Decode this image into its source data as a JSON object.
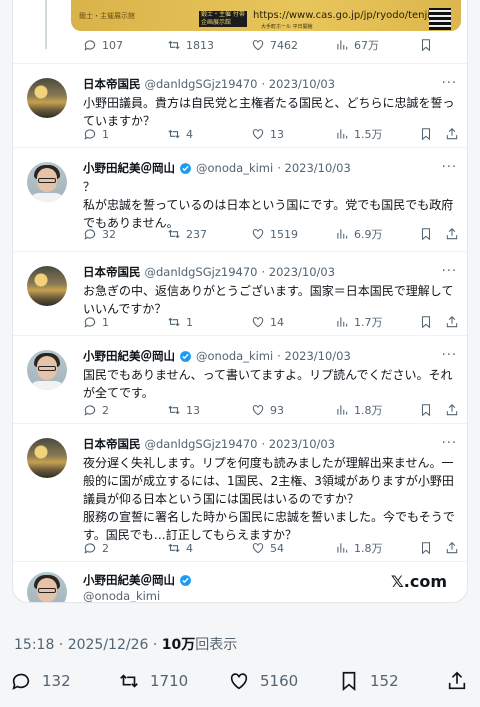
{
  "top_tweet": {
    "banner": {
      "stamp": "鍛士・主催展示館",
      "box_text": "鍛士・主催 付帯企画展示館",
      "url": "https://www.cas.go.jp/jp/ryodo/tenjikan",
      "sub": "大手町ホール 平日開館"
    },
    "stats": {
      "replies": "107",
      "reposts": "1813",
      "likes": "7462",
      "views": "67万"
    }
  },
  "tweets": [
    {
      "avatar": "landscape",
      "name": "日本帝国民",
      "handle": "@danldgSGjz19470",
      "date": "· 2023/10/03",
      "verified": false,
      "text": "小野田議員。貴方は自民党と主権者たる国民と、どちらに忠誠を誓っていますか？",
      "replies": "1",
      "reposts": "4",
      "likes": "13",
      "views": "1.5万"
    },
    {
      "avatar": "person",
      "name": "小野田紀美＠岡山",
      "handle": "@onoda_kimi",
      "date": "· 2023/10/03",
      "verified": true,
      "text": "？\n私が忠誠を誓っているのは日本という国にです。党でも国民でも政府でもありません。",
      "replies": "32",
      "reposts": "237",
      "likes": "1519",
      "views": "6.9万"
    },
    {
      "avatar": "landscape",
      "name": "日本帝国民",
      "handle": "@danldgSGjz19470",
      "date": "· 2023/10/03",
      "verified": false,
      "text": "お急ぎの中、返信ありがとうございます。国家＝日本国民で理解していいんですか？",
      "replies": "1",
      "reposts": "1",
      "likes": "14",
      "views": "1.7万"
    },
    {
      "avatar": "person",
      "name": "小野田紀美＠岡山",
      "handle": "@onoda_kimi",
      "date": "· 2023/10/03",
      "verified": true,
      "text": "国民でもありません、って書いてますよ。リプ読んでください。それが全てです。",
      "replies": "2",
      "reposts": "13",
      "likes": "93",
      "views": "1.8万"
    },
    {
      "avatar": "landscape",
      "name": "日本帝国民",
      "handle": "@danldgSGjz19470",
      "date": "· 2023/10/03",
      "verified": false,
      "text": "夜分遅く失礼します。リプを何度も読みましたが理解出来ません。一般的に国が成立するには、1国民、2主権、3領域がありますが小野田議員が仰る日本という国には国民はいるのですか？\n服務の宣誓に署名した時から国民に忠誠を誓いました。今でもそうです。国民でも…訂正してもらえますか？",
      "replies": "2",
      "reposts": "4",
      "likes": "54",
      "views": "1.8万"
    }
  ],
  "footer_tweet": {
    "name": "小野田紀美＠岡山",
    "handle": "@onoda_kimi",
    "brand": "𝕏.com"
  },
  "post_meta": {
    "time": "15:18 · 2025/12/26 · ",
    "views_count": "10万",
    "views_label": "回表示"
  },
  "bottom_bar": {
    "replies": "132",
    "reposts": "1710",
    "likes": "5160",
    "bookmarks": "152"
  },
  "icons": {
    "reply": "reply-icon",
    "repost": "repost-icon",
    "like": "heart-icon",
    "views": "views-icon",
    "bookmark": "bookmark-icon",
    "share": "share-icon",
    "more": "more-icon",
    "verified": "verified-icon"
  },
  "colors": {
    "verified": "#1d9bf0",
    "muted": "#536471",
    "text": "#0f1419"
  }
}
